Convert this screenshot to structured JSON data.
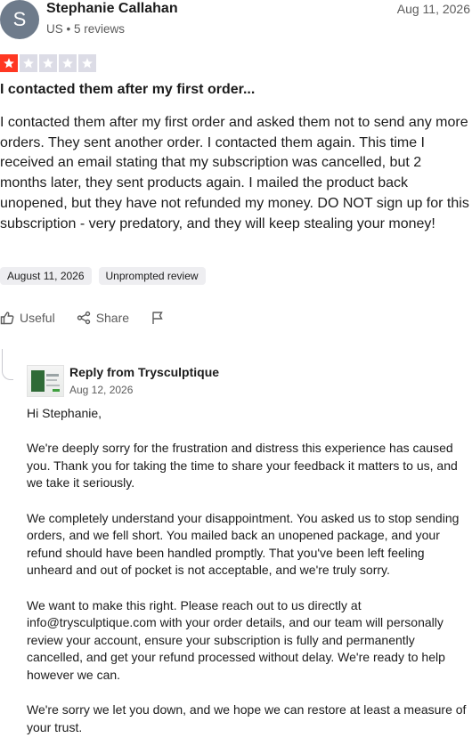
{
  "review": {
    "avatar_letter": "S",
    "reviewer_name": "Stephanie Callahan",
    "country": "US",
    "review_count": "5 reviews",
    "date": "Aug 11, 2026",
    "rating": 1,
    "rating_max": 5,
    "title": "I contacted them after my first order...",
    "body": "I contacted them after my first order and asked them not to send any more orders. They sent another order. I contacted them again. This time I received an email stating that my subscription was cancelled, but 2 months later, they sent products again. I mailed the product back unopened, but they have not refunded my money. DO NOT sign up for this subscription - very predatory, and they will keep stealing your money!",
    "experience_date": "August 11, 2026",
    "review_type": "Unprompted review"
  },
  "actions": {
    "useful_label": "Useful",
    "share_label": "Share"
  },
  "reply": {
    "from_label": "Reply from Trysculptique",
    "date": "Aug 12, 2026",
    "paragraphs": [
      "Hi Stephanie,",
      "We're deeply sorry for the frustration and distress this experience has caused you. Thank you for taking the time to share your feedback it matters to us, and we take it seriously.",
      "We completely understand your disappointment. You asked us to stop sending orders, and we fell short. You mailed back an unopened package, and your refund should have been handled promptly. That you've been left feeling unheard and out of pocket is not acceptable, and we're truly sorry.",
      "We want to make this right. Please reach out to us directly at info@trysculptique.com with your order details, and our team will personally review your account, ensure your subscription is fully and permanently cancelled, and get your refund processed without delay. We're ready to help however we can.",
      "We're sorry we let you down, and we hope we can restore at least a measure of your trust."
    ]
  },
  "colors": {
    "star_on": "#ff3722",
    "star_off": "#dcdce6",
    "chip_bg": "#eeeef1"
  },
  "icons": {
    "useful": "thumbs-up-icon",
    "share": "share-icon",
    "report": "flag-icon"
  }
}
